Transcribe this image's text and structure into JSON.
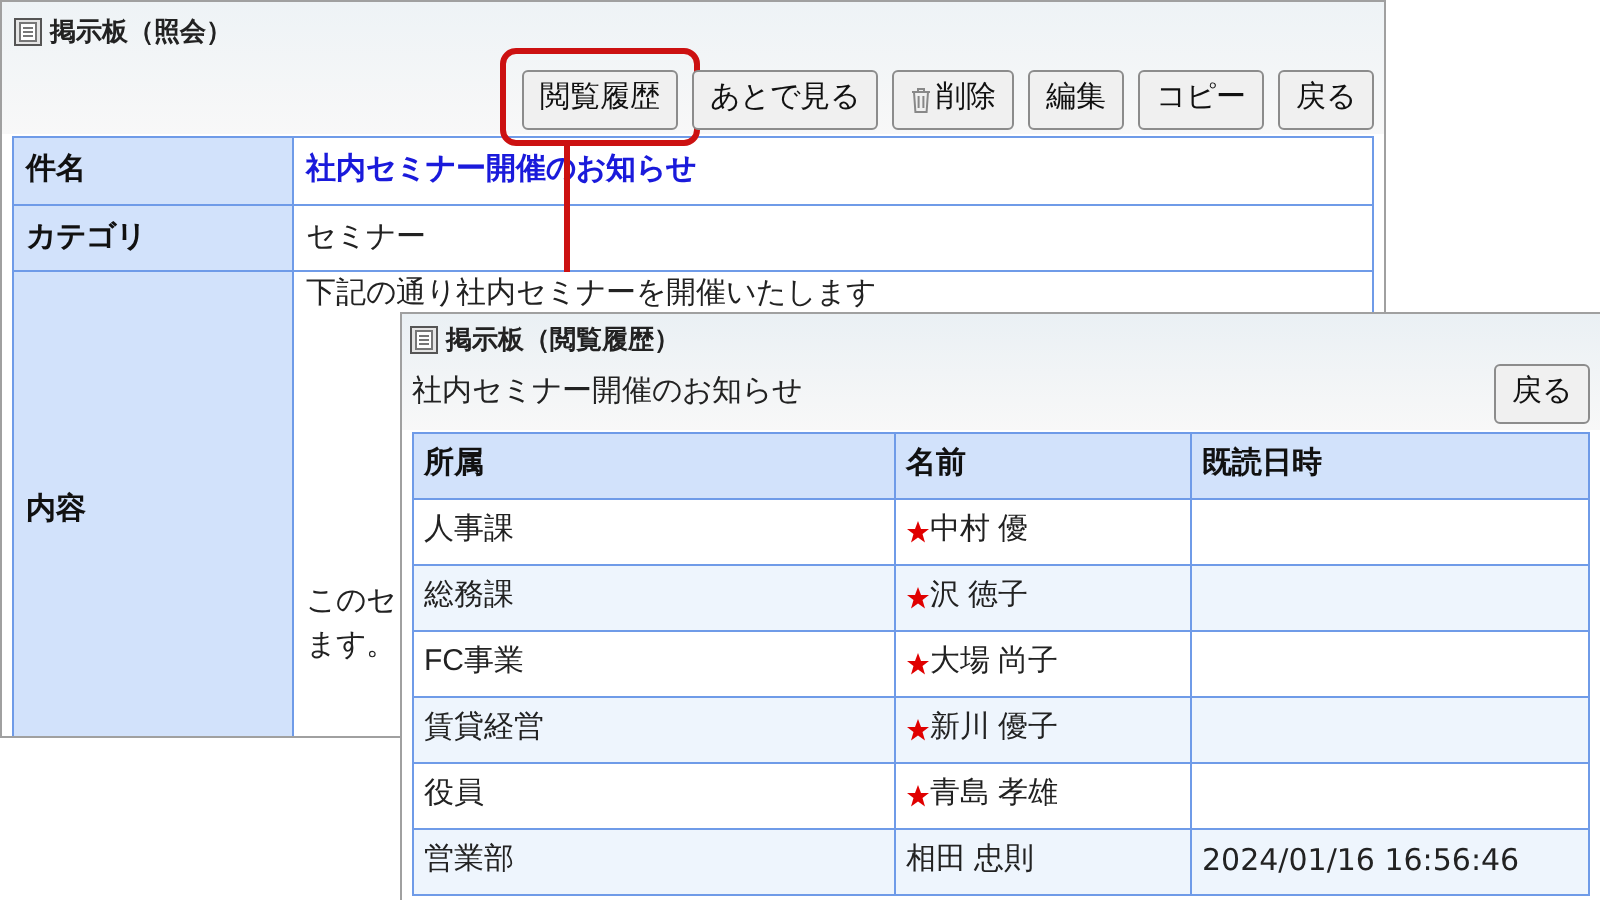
{
  "main_window": {
    "title": "掲示板（照会）",
    "buttons": [
      {
        "label": "閲覧履歴",
        "kind": "plain",
        "highlighted": true
      },
      {
        "label": "あとで見る",
        "kind": "plain",
        "highlighted": false
      },
      {
        "label": "削除",
        "kind": "delete",
        "highlighted": false
      },
      {
        "label": "編集",
        "kind": "plain",
        "highlighted": false
      },
      {
        "label": "コピー",
        "kind": "plain",
        "highlighted": false
      },
      {
        "label": "戻る",
        "kind": "plain",
        "highlighted": false
      }
    ],
    "fields": [
      {
        "label": "件名",
        "kind": "link",
        "value": "社内セミナー開催のお知らせ"
      },
      {
        "label": "カテゴリ",
        "kind": "text",
        "value": "セミナー"
      },
      {
        "label": "内容",
        "kind": "lines",
        "paragraphs": [
          [
            "下記の通り社内セミナーを開催いたします"
          ],
          [
            "このセ",
            "ます。"
          ]
        ]
      }
    ]
  },
  "history_window": {
    "title": "掲示板（閲覧履歴）",
    "subject": "社内セミナー開催のお知らせ",
    "back_button": "戻る",
    "columns": [
      "所属",
      "名前",
      "既読日時"
    ],
    "rows": [
      {
        "department": "人事課",
        "name": "中村 優",
        "starred": true
      },
      {
        "department": "総務課",
        "name": "沢 徳子",
        "starred": true
      },
      {
        "department": "FC事業",
        "name": "大場 尚子",
        "starred": true
      },
      {
        "department": "賃貸経営",
        "name": "新川 優子",
        "starred": true
      },
      {
        "department": "役員",
        "name": "青島 孝雄",
        "starred": true
      },
      {
        "department": "営業部",
        "name": "相田 忠則",
        "starred": false,
        "read_at": "2024/01/16 16:56:46"
      }
    ]
  }
}
